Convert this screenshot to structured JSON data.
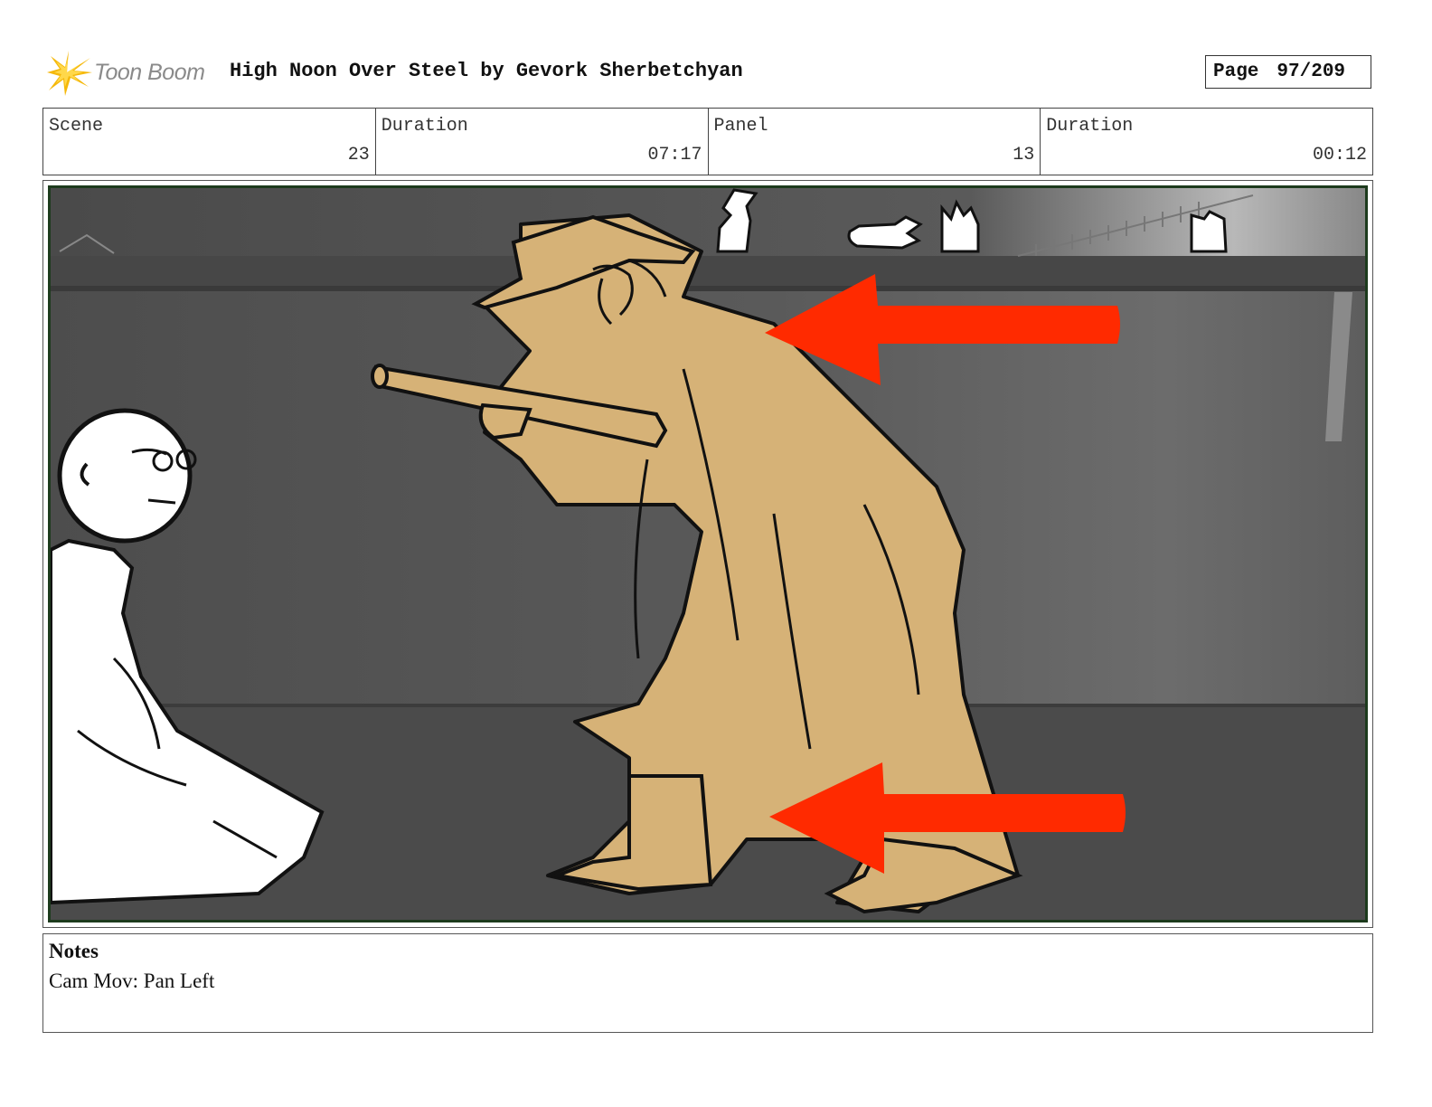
{
  "header": {
    "logo_text": "Toon Boom",
    "title": "High Noon Over Steel by Gevork Sherbetchyan",
    "page_label": "Page",
    "page_value": "97/209"
  },
  "info": {
    "scene_label": "Scene",
    "scene_value": "23",
    "scene_duration_label": "Duration",
    "scene_duration_value": "07:17",
    "panel_label": "Panel",
    "panel_value": "13",
    "panel_duration_label": "Duration",
    "panel_duration_value": "00:12"
  },
  "notes": {
    "title": "Notes",
    "body": "Cam Mov: Pan Left"
  },
  "colors": {
    "arrow": "#ff2a00",
    "coat": "#d6b277",
    "background": "#575757",
    "frame_border": "#1d3b1d"
  }
}
